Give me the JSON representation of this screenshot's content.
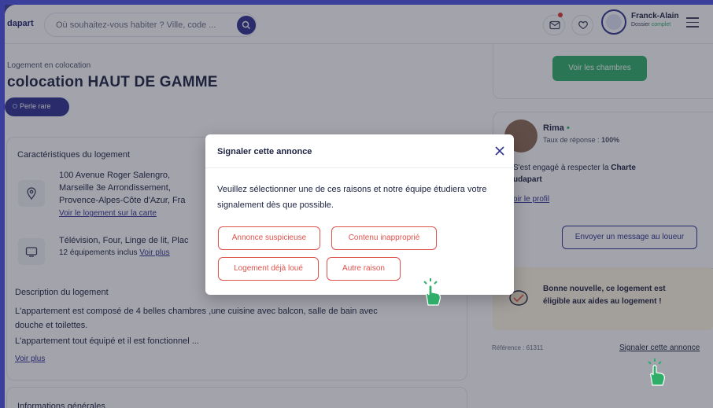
{
  "header": {
    "logo": "dapart",
    "search_placeholder": "Où souhaitez-vous habiter ? Ville, code ...",
    "user_name": "Franck-Alain",
    "user_status_prefix": "Dossier",
    "user_status_value": "complet"
  },
  "listing": {
    "kicker": "Logement en colocation",
    "title": "colocation HAUT DE GAMME",
    "badge": "Perle rare",
    "features_heading": "Caractéristiques du logement",
    "address_lines": [
      "100 Avenue Roger Salengro,",
      "Marseille 3e Arrondissement,",
      "Provence-Alpes-Côte d'Azur, Fra"
    ],
    "map_link": "Voir le logement sur la carte",
    "equipments": "Télévision, Four, Linge de lit, Plac",
    "equipments_count": "12 équipements inclus",
    "equipments_more": "Voir plus",
    "description_heading": "Description du logement",
    "description_lines": [
      "L'appartement est composé de 4 belles chambres ,une cuisine avec balcon, salle de bain avec",
      "douche et toilettes.",
      "L'appartement tout équipé et il est fonctionnel ..."
    ],
    "description_more": "Voir plus",
    "general_info_heading": "Informations générales"
  },
  "sidebar": {
    "rooms_button": "Voir les chambres",
    "host_name": "Rima",
    "host_dot": "•",
    "response_rate_label": "Taux de réponse :",
    "response_rate_value": "100%",
    "charter_line1": "S'est engagé à respecter la",
    "charter_bold": "Charte",
    "charter_line2": "udapart",
    "profile_link": "oir le profil",
    "message_button": "Envoyer un message au loueur",
    "aid_line1": "Bonne nouvelle, ce logement est",
    "aid_line2": "éligible aux aides au logement !",
    "reference": "Référence : 61311",
    "report_link": "Signaler cette annonce"
  },
  "modal": {
    "title": "Signaler cette annonce",
    "body": "Veuillez sélectionner une de ces raisons et notre équipe étudiera votre signalement dès que possible.",
    "reasons": [
      "Annonce suspicieuse",
      "Contenu inapproprié",
      "Logement déjà loué",
      "Autre raison"
    ]
  },
  "colors": {
    "brand": "#2d2f8f",
    "accent_green": "#2fae6a",
    "danger": "#e0524c",
    "frame": "#3a3f9c"
  }
}
